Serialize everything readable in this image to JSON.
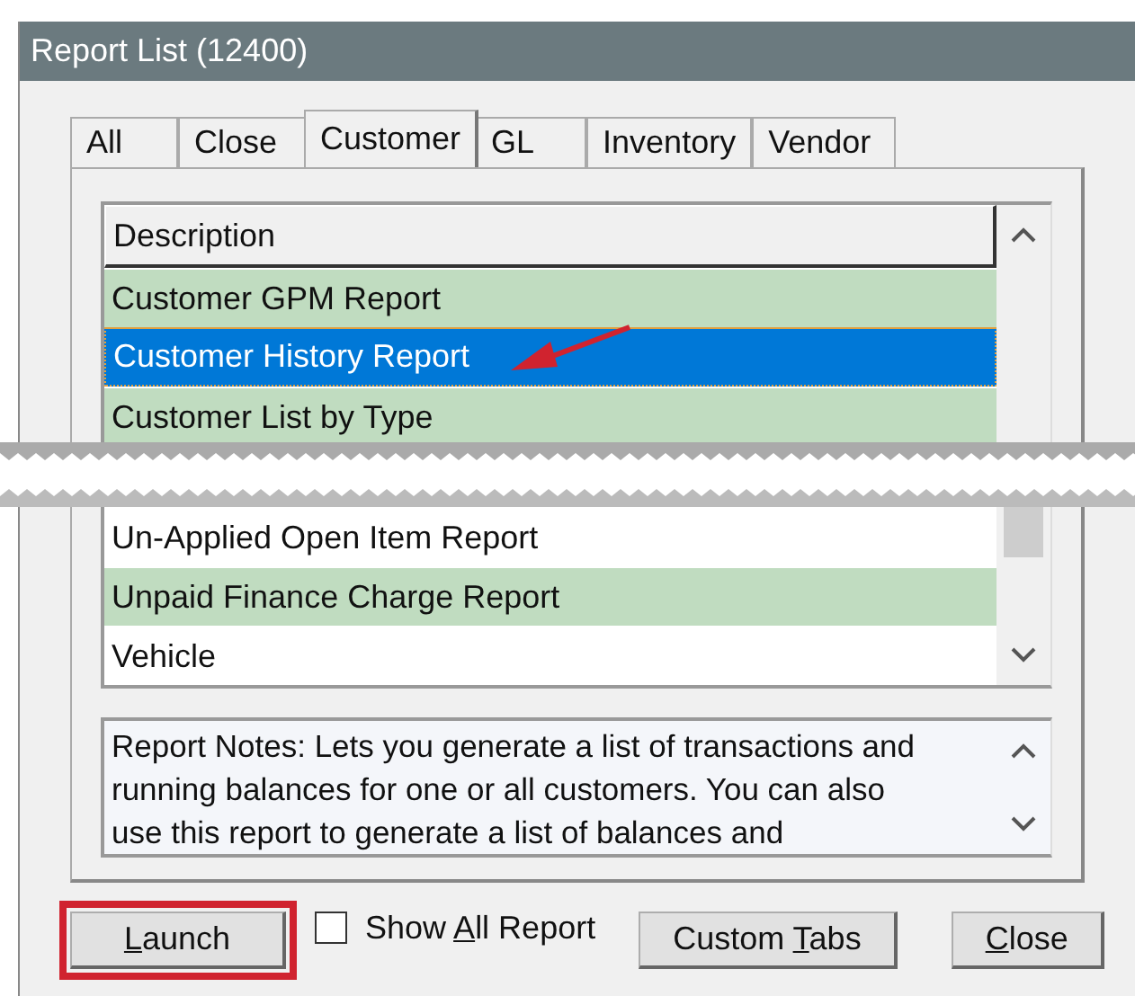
{
  "window": {
    "title": "Report List (12400)"
  },
  "tabs": [
    {
      "label": "All",
      "selected": false
    },
    {
      "label": "Close",
      "selected": false
    },
    {
      "label": "Customer",
      "selected": true
    },
    {
      "label": "GL",
      "selected": false
    },
    {
      "label": "Inventory",
      "selected": false
    },
    {
      "label": "Vendor",
      "selected": false
    }
  ],
  "list": {
    "column": "Description",
    "rows_top": [
      {
        "text": "Customer GPM Report",
        "shaded": true,
        "selected": false
      },
      {
        "text": "Customer History Report",
        "shaded": false,
        "selected": true
      },
      {
        "text": "Customer List by Type",
        "shaded": true,
        "selected": false
      }
    ],
    "rows_bottom": [
      {
        "text": "Un-Applied Open Item Report",
        "shaded": false,
        "selected": false
      },
      {
        "text": "Unpaid Finance Charge Report",
        "shaded": true,
        "selected": false
      },
      {
        "text": "Vehicle",
        "shaded": false,
        "selected": false
      }
    ]
  },
  "notes": {
    "text": "Report Notes:  Lets you generate a list of transactions and running balances for one or all customers. You can also use this report to generate a list of balances and"
  },
  "buttons": [
    {
      "key": "L",
      "after": "aunch",
      "highlighted": true
    },
    {
      "kind": "checkbox",
      "before": "Show ",
      "key": "A",
      "after": "ll Report",
      "checked": false
    },
    {
      "before": "Custom ",
      "key": "T",
      "after": "abs",
      "highlighted": false
    },
    {
      "key": "C",
      "after": "lose",
      "highlighted": false
    }
  ]
}
